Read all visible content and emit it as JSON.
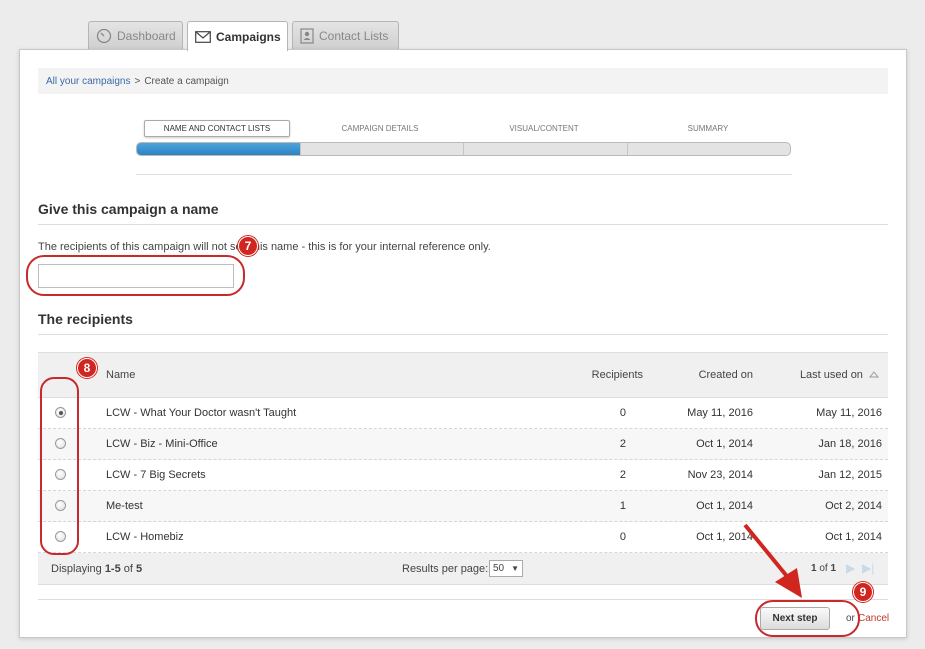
{
  "tabs": [
    {
      "label": "Dashboard",
      "icon": "gauge-icon"
    },
    {
      "label": "Campaigns",
      "icon": "envelope-icon",
      "active": true
    },
    {
      "label": "Contact Lists",
      "icon": "contacts-book-icon"
    }
  ],
  "breadcrumb": {
    "link": "All your campaigns",
    "separator": ">",
    "current": "Create a campaign"
  },
  "steps": [
    {
      "label": "NAME AND CONTACT LISTS",
      "active": true
    },
    {
      "label": "CAMPAIGN DETAILS"
    },
    {
      "label": "VISUAL/CONTENT"
    },
    {
      "label": "SUMMARY"
    }
  ],
  "progress_completed_steps": 1,
  "name_section": {
    "title": "Give this campaign a name",
    "help_text": "The recipients of this campaign will not see this name - this is for your internal reference only.",
    "input_value": ""
  },
  "recipients": {
    "title": "The recipients",
    "columns": {
      "name": "Name",
      "recipients": "Recipients",
      "created": "Created on",
      "last_used": "Last used on"
    },
    "sort_icon": "sort-up-icon",
    "rows": [
      {
        "name": "LCW - What Your Doctor wasn't Taught",
        "recipients": "0",
        "created": "May 11, 2016",
        "last_used": "May 11, 2016",
        "selected": true
      },
      {
        "name": "LCW - Biz - Mini-Office",
        "recipients": "2",
        "created": "Oct 1, 2014",
        "last_used": "Jan 18, 2016",
        "selected": false
      },
      {
        "name": "LCW - 7 Big Secrets",
        "recipients": "2",
        "created": "Nov 23, 2014",
        "last_used": "Jan 12, 2015",
        "selected": false
      },
      {
        "name": "Me-test",
        "recipients": "1",
        "created": "Oct 1, 2014",
        "last_used": "Oct 2, 2014",
        "selected": false
      },
      {
        "name": "LCW - Homebiz",
        "recipients": "0",
        "created": "Oct 1, 2014",
        "last_used": "Oct 1, 2014",
        "selected": false
      }
    ],
    "footer": {
      "displaying_prefix": "Displaying",
      "range": "1-5",
      "of_text": "of",
      "total": "5",
      "results_per_page_label": "Results per page:",
      "per_page_value": "50",
      "page_current": "1",
      "page_of": "of",
      "page_total": "1"
    }
  },
  "actions": {
    "next_label": "Next step",
    "or_text": "or",
    "cancel_label": "Cancel"
  },
  "annotations": [
    {
      "number": "7"
    },
    {
      "number": "8"
    },
    {
      "number": "9"
    }
  ],
  "colors": {
    "accent_blue": "#2a83c4",
    "annotation_red": "#c72a2a",
    "link_blue": "#3a6aa8"
  }
}
